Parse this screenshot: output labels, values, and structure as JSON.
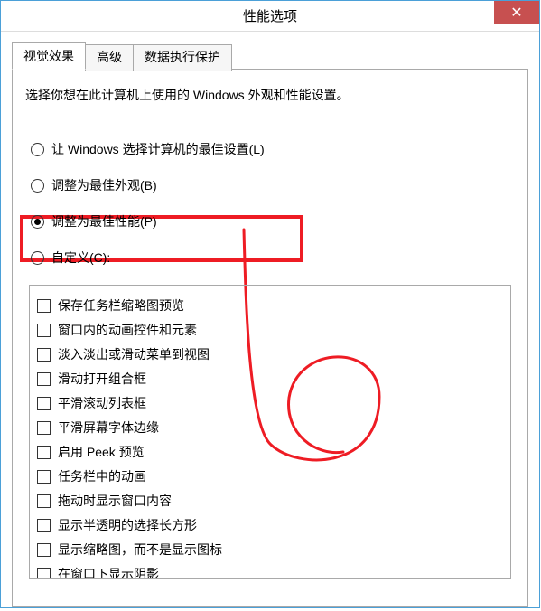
{
  "window": {
    "title": "性能选项"
  },
  "tabs": {
    "visual": "视觉效果",
    "advanced": "高级",
    "dep": "数据执行保护"
  },
  "panel": {
    "description": "选择你想在此计算机上使用的 Windows 外观和性能设置。"
  },
  "radios": {
    "let_windows": "让 Windows 选择计算机的最佳设置(L)",
    "best_appearance": "调整为最佳外观(B)",
    "best_performance": "调整为最佳性能(P)",
    "custom": "自定义(C):"
  },
  "checks": {
    "c0": "保存任务栏缩略图预览",
    "c1": "窗口内的动画控件和元素",
    "c2": "淡入淡出或滑动菜单到视图",
    "c3": "滑动打开组合框",
    "c4": "平滑滚动列表框",
    "c5": "平滑屏幕字体边缘",
    "c6": "启用 Peek 预览",
    "c7": "任务栏中的动画",
    "c8": "拖动时显示窗口内容",
    "c9": "显示半透明的选择长方形",
    "c10": "显示缩略图，而不是显示图标",
    "c11": "在窗口下显示阴影"
  }
}
